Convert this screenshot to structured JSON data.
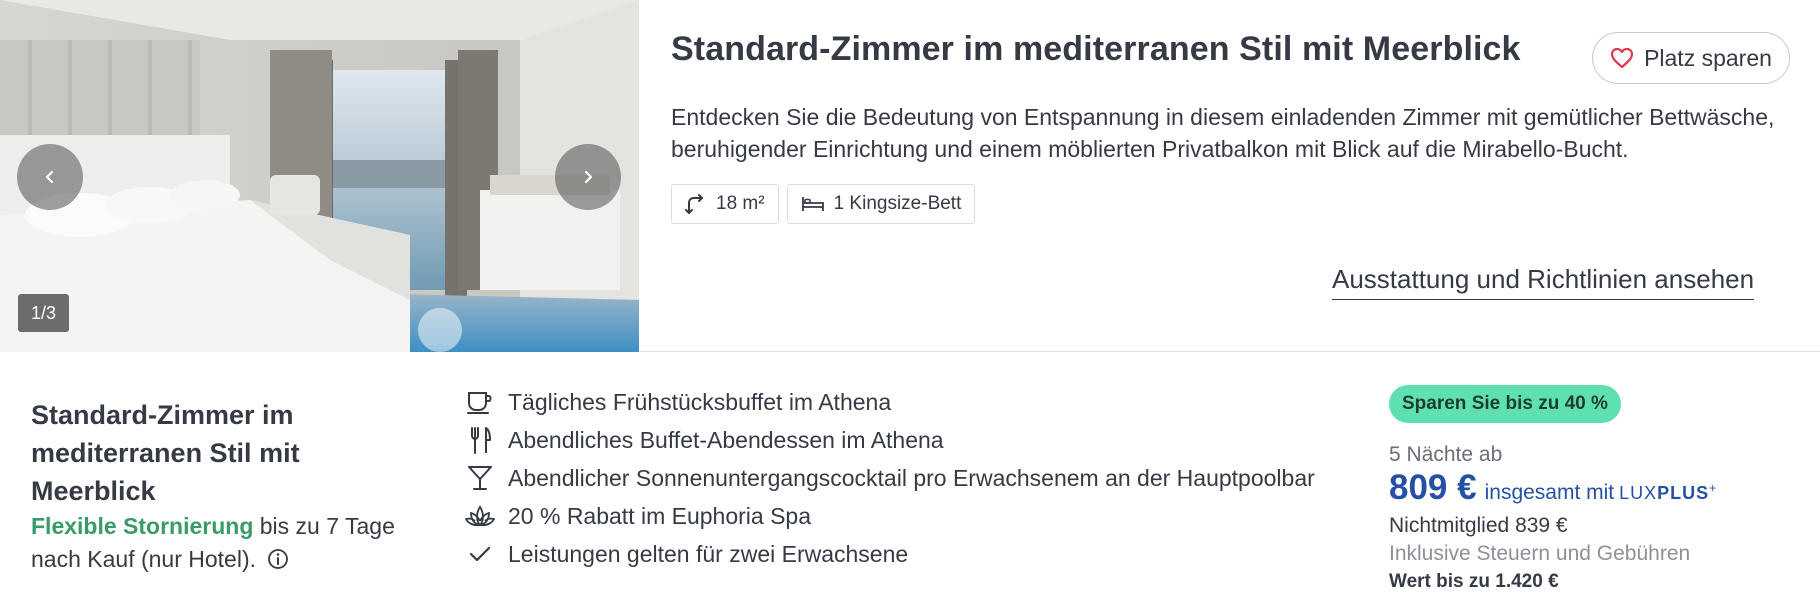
{
  "gallery": {
    "counter": "1/3",
    "prev_icon": "chevron-left-icon",
    "next_icon": "chevron-right-icon"
  },
  "room": {
    "title": "Standard-Zimmer im mediterranen Stil mit Meerblick",
    "save_label": "Platz sparen",
    "save_icon": "heart-icon",
    "description": "Entdecken Sie die Bedeutung von Entspannung in diesem einladenden Zimmer mit gemütlicher Bettwäsche, beruhigender Einrichtung und einem möblierten Privatbalkon mit Blick auf die Mirabello-Bucht.",
    "chips": [
      {
        "icon": "room-size-icon",
        "label": "18 m²"
      },
      {
        "icon": "bed-icon",
        "label": "1 Kingsize-Bett"
      }
    ],
    "amenities_link": "Ausstattung und Richtlinien ansehen"
  },
  "rate": {
    "title": "Standard-Zimmer im mediterranen Stil mit Meerblick",
    "cancellation_highlight": "Flexible Stornierung",
    "cancellation_rest": " bis zu 7 Tage nach Kauf (nur Hotel).",
    "info_icon": "info-icon"
  },
  "inclusions": [
    {
      "icon": "coffee-cup-icon",
      "label": "Tägliches Frühstücksbuffet im Athena"
    },
    {
      "icon": "cutlery-icon",
      "label": "Abendliches Buffet-Abendessen im Athena"
    },
    {
      "icon": "cocktail-icon",
      "label": "Abendlicher Sonnenuntergangscocktail pro Erwachsenem an der Hauptpoolbar"
    },
    {
      "icon": "lotus-icon",
      "label": "20 % Rabatt im Euphoria Spa"
    },
    {
      "icon": "checkmark-icon",
      "label": "Leistungen gelten für zwei Erwachsene"
    }
  ],
  "pricing": {
    "badge": "Sparen Sie bis zu 40 %",
    "nights": "5 Nächte ab",
    "price": "809 €",
    "price_suffix": "insgesamt mit",
    "luxplus_a": "LUX",
    "luxplus_b": "PLUS",
    "luxplus_c": "+",
    "nonmember_label": "Nichtmitglied",
    "nonmember_price": "839 €",
    "taxes": "Inklusive Steuern und Gebühren",
    "value": "Wert bis zu 1.420 €"
  },
  "colors": {
    "text": "#363a45",
    "accent_green": "#3a9a69",
    "price_blue": "#2451a6",
    "badge_bg": "#5fe0b0",
    "heart": "#e2384d"
  }
}
